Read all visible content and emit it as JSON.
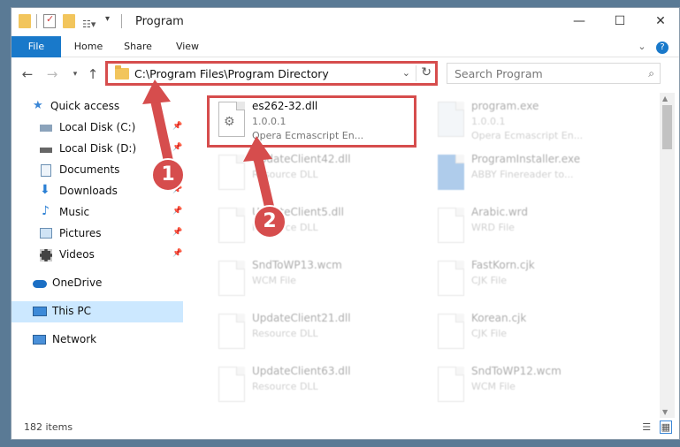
{
  "window": {
    "title": "Program",
    "controls": {
      "minimize": "—",
      "maximize": "☐",
      "close": "✕"
    }
  },
  "ribbon": {
    "tabs": [
      "File",
      "Home",
      "Share",
      "View"
    ]
  },
  "address": {
    "path": "C:\\Program Files\\Program Directory",
    "search_placeholder": "Search Program"
  },
  "nav": {
    "items": [
      {
        "label": "Quick access",
        "pinned": false
      },
      {
        "label": "Local Disk (C:)",
        "pinned": true
      },
      {
        "label": "Local Disk (D:)",
        "pinned": true
      },
      {
        "label": "Documents",
        "pinned": true
      },
      {
        "label": "Downloads",
        "pinned": true
      },
      {
        "label": "Music",
        "pinned": true
      },
      {
        "label": "Pictures",
        "pinned": true
      },
      {
        "label": "Videos",
        "pinned": true
      },
      {
        "label": "OneDrive",
        "pinned": false
      },
      {
        "label": "This PC",
        "pinned": false,
        "selected": true
      },
      {
        "label": "Network",
        "pinned": false
      }
    ]
  },
  "files": {
    "left": [
      {
        "name": "es262-32.dll",
        "line1": "1.0.0.1",
        "line2": "Opera Ecmascript En...",
        "highlighted": true
      },
      {
        "name": "UpdateClient42.dll",
        "line1": "Resource DLL",
        "line2": ""
      },
      {
        "name": "UpdateClient5.dll",
        "line1": "Resource DLL",
        "line2": ""
      },
      {
        "name": "SndToWP13.wcm",
        "line1": "WCM File",
        "line2": ""
      },
      {
        "name": "UpdateClient21.dll",
        "line1": "Resource DLL",
        "line2": ""
      },
      {
        "name": "UpdateClient63.dll",
        "line1": "Resource DLL",
        "line2": ""
      }
    ],
    "right": [
      {
        "name": "program.exe",
        "line1": "1.0.0.1",
        "line2": "Opera Ecmascript En..."
      },
      {
        "name": "ProgramInstaller.exe",
        "line1": "ABBY Finereader to...",
        "line2": ""
      },
      {
        "name": "Arabic.wrd",
        "line1": "WRD File",
        "line2": ""
      },
      {
        "name": "FastKorn.cjk",
        "line1": "CJK File",
        "line2": ""
      },
      {
        "name": "Korean.cjk",
        "line1": "CJK File",
        "line2": ""
      },
      {
        "name": "SndToWP12.wcm",
        "line1": "WCM File",
        "line2": ""
      }
    ]
  },
  "status": {
    "items": "182 items"
  },
  "annotations": {
    "step1": "1",
    "step2": "2",
    "color": "#d64d4d"
  }
}
